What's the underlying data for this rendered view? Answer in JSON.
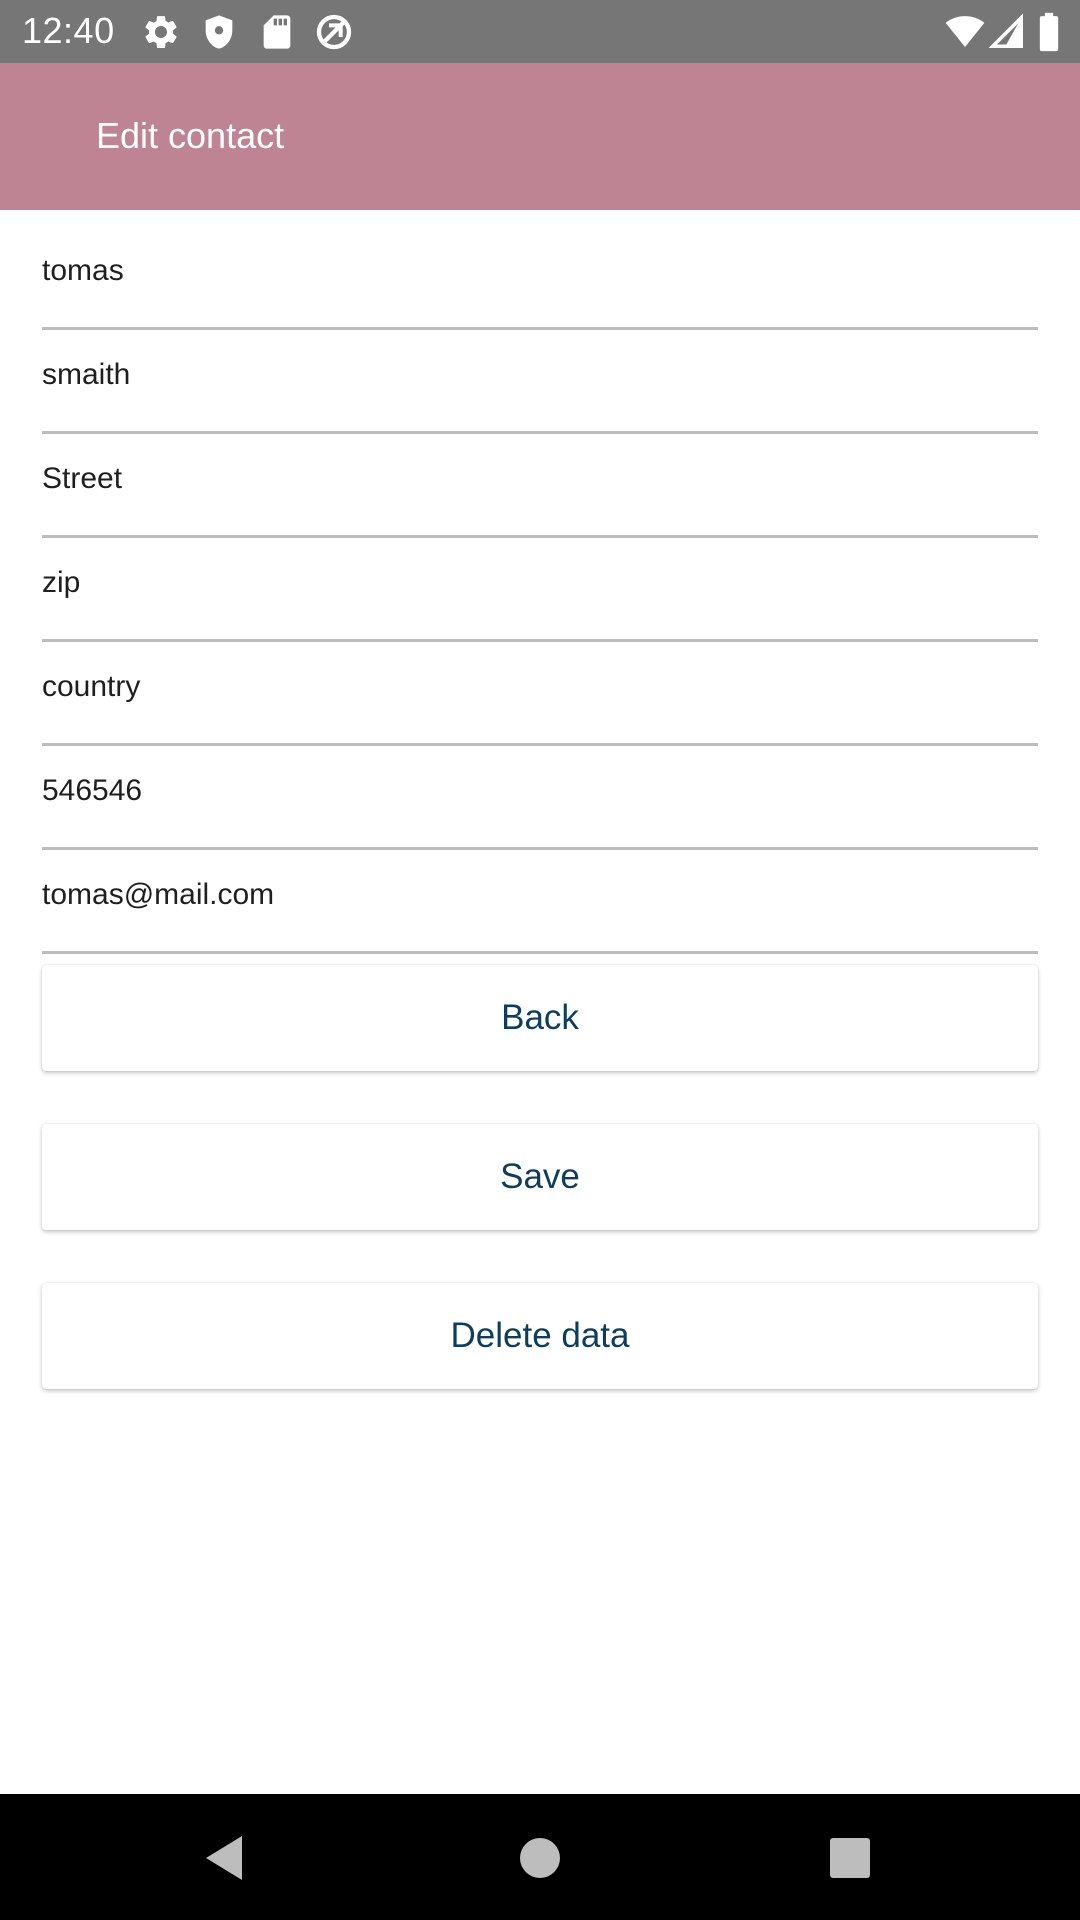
{
  "status_bar": {
    "time": "12:40",
    "left_icons": [
      "settings-gear-icon",
      "shield-icon",
      "sd-card-icon",
      "no-data-sync-icon"
    ],
    "right_icons": [
      "wifi-icon",
      "cell-signal-icon",
      "battery-icon"
    ]
  },
  "app_bar": {
    "title": "Edit contact",
    "color": "#bf8494"
  },
  "form": {
    "fields": [
      {
        "name": "first-name",
        "value": "tomas"
      },
      {
        "name": "last-name",
        "value": "smaith"
      },
      {
        "name": "street",
        "value": "Street"
      },
      {
        "name": "zip",
        "value": "zip"
      },
      {
        "name": "country",
        "value": "country"
      },
      {
        "name": "phone",
        "value": "546546"
      },
      {
        "name": "email",
        "value": "tomas@mail.com"
      }
    ]
  },
  "buttons": {
    "back_label": "Back",
    "save_label": "Save",
    "delete_label": "Delete data",
    "text_color": "#0e3d5e"
  },
  "nav_bar": {
    "icons": [
      "back-triangle-icon",
      "home-circle-icon",
      "recents-square-icon"
    ]
  }
}
